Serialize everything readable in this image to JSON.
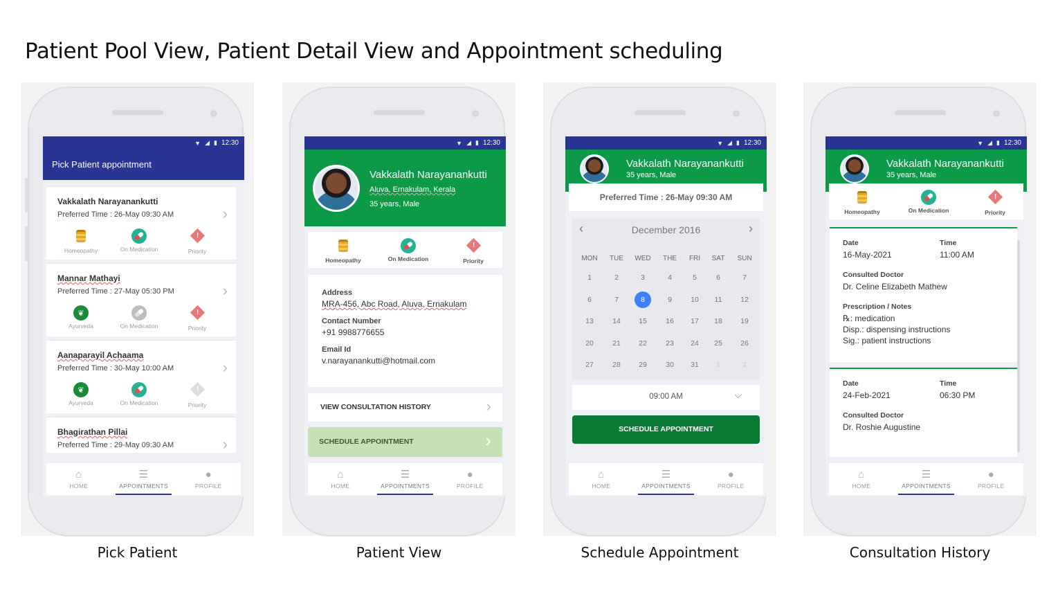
{
  "title": "Patient Pool View, Patient Detail View and Appointment scheduling",
  "captions": [
    "Pick Patient",
    "Patient View",
    "Schedule Appointment",
    "Consultation History"
  ],
  "status_bar": {
    "time": "12:30"
  },
  "tabbar": {
    "home": "HOME",
    "appointments": "APPOINTMENTS",
    "profile": "PROFILE"
  },
  "labels": {
    "homeopathy": "Homeopathy",
    "on_medication": "On Medication",
    "priority": "Priority",
    "ayurveda": "Ayurveda"
  },
  "screen1": {
    "app_bar_title": "Pick Patient appointment",
    "patients": [
      {
        "name": "Vakkalath Narayanankutti",
        "time": "Preferred Time : 26-May 09:30 AM"
      },
      {
        "name": "Mannar Mathayi",
        "time": "Preferred Time : 27-May 05:30 PM"
      },
      {
        "name": "Aanaparayil Achaama",
        "time": "Preferred Time : 30-May 10:00 AM"
      },
      {
        "name": "Bhagirathan Pillai",
        "time": "Preferred Time : 29-May 09:30 AM"
      }
    ]
  },
  "patient": {
    "name": "Vakkalath Narayanankutti",
    "location": "Aluva, Ernakulam, Kerala",
    "age_sex": "35 years, Male"
  },
  "screen2": {
    "address_label": "Address",
    "address": "MRA-456, Abc Road, Aluva, Ernakulam",
    "contact_label": "Contact Number",
    "contact": "+91 9988776655",
    "email_label": "Email Id",
    "email": "v.narayanankutti@hotmail.com",
    "history_button": "VIEW CONSULTATION HISTORY",
    "schedule_button": "SCHEDULE APPOINTMENT"
  },
  "screen3": {
    "preferred": "Preferred Time : 26-May 09:30 AM",
    "month": "December 2016",
    "weekdays": [
      "MON",
      "TUE",
      "WED",
      "THE",
      "FRI",
      "SAT",
      "SUN"
    ],
    "weeks": [
      [
        "1",
        "2",
        "3",
        "4",
        "5",
        "6",
        "7"
      ],
      [
        "6",
        "7",
        "8",
        "9",
        "10",
        "11",
        "12"
      ],
      [
        "13",
        "14",
        "15",
        "16",
        "17",
        "18",
        "19"
      ],
      [
        "20",
        "21",
        "22",
        "23",
        "24",
        "25",
        "26"
      ],
      [
        "27",
        "28",
        "29",
        "30",
        "31",
        "1",
        "2"
      ]
    ],
    "selected_day": "8",
    "time_value": "09:00 AM",
    "schedule_button": "SCHEDULE APPOINTMENT"
  },
  "screen4": {
    "records": [
      {
        "date_label": "Date",
        "date": "16-May-2021",
        "time_label": "Time",
        "time": "11:00 AM",
        "doctor_label": "Consulted Doctor",
        "doctor": "Dr. Celine Elizabeth Mathew",
        "notes_label": "Prescription / Notes",
        "rx": "℞:  medication",
        "disp": "Disp.:  dispensing instructions",
        "sig": "Sig.: patient instructions"
      },
      {
        "date_label": "Date",
        "date": "24-Feb-2021",
        "time_label": "Time",
        "time": "06:30 PM",
        "doctor_label": "Consulted Doctor",
        "doctor": "Dr. Roshie Augustine"
      }
    ]
  },
  "colors": {
    "indigo": "#283593",
    "green": "#0c9a48",
    "dark_green": "#0a7a35",
    "light_green": "#c5e1b5",
    "selected_day": "#3b82f6"
  }
}
